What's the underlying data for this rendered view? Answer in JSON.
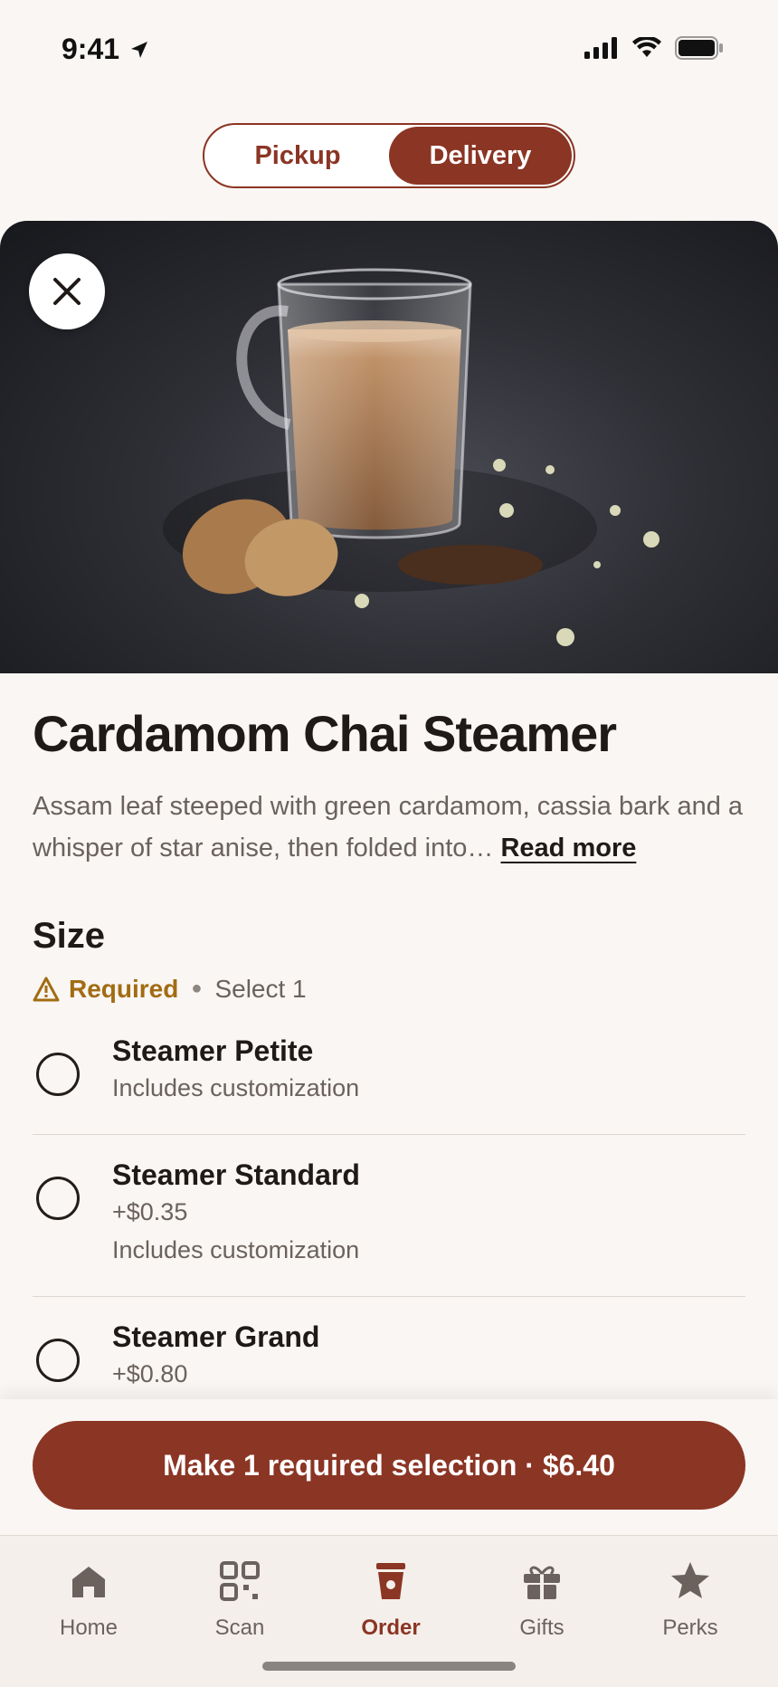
{
  "status_bar": {
    "time": "9:41"
  },
  "fulfillment": {
    "options": [
      "Pickup",
      "Delivery"
    ],
    "selected": "Delivery"
  },
  "product": {
    "title": "Cardamom Chai Steamer",
    "description": "Assam leaf steeped with green cardamom, cassia bark and a whisper of star anise, then folded into…",
    "read_more": "Read more"
  },
  "size": {
    "title": "Size",
    "required_label": "Required",
    "select_hint": "Select 1",
    "options": [
      {
        "name": "Steamer Petite",
        "price": "",
        "note": "Includes customization"
      },
      {
        "name": "Steamer Standard",
        "price": "+$0.35",
        "note": "Includes customization"
      },
      {
        "name": "Steamer Grand",
        "price": "+$0.80",
        "note": ""
      }
    ]
  },
  "cta": {
    "label": "Make 1 required selection · $6.40"
  },
  "tabs": [
    {
      "label": "Home",
      "icon": "home-icon"
    },
    {
      "label": "Scan",
      "icon": "qr-icon"
    },
    {
      "label": "Order",
      "icon": "cup-icon",
      "active": true
    },
    {
      "label": "Gifts",
      "icon": "gift-icon"
    },
    {
      "label": "Perks",
      "icon": "star-icon"
    }
  ],
  "colors": {
    "accent": "#8b3524",
    "warning": "#a26c13",
    "background": "#f9f6f3"
  }
}
